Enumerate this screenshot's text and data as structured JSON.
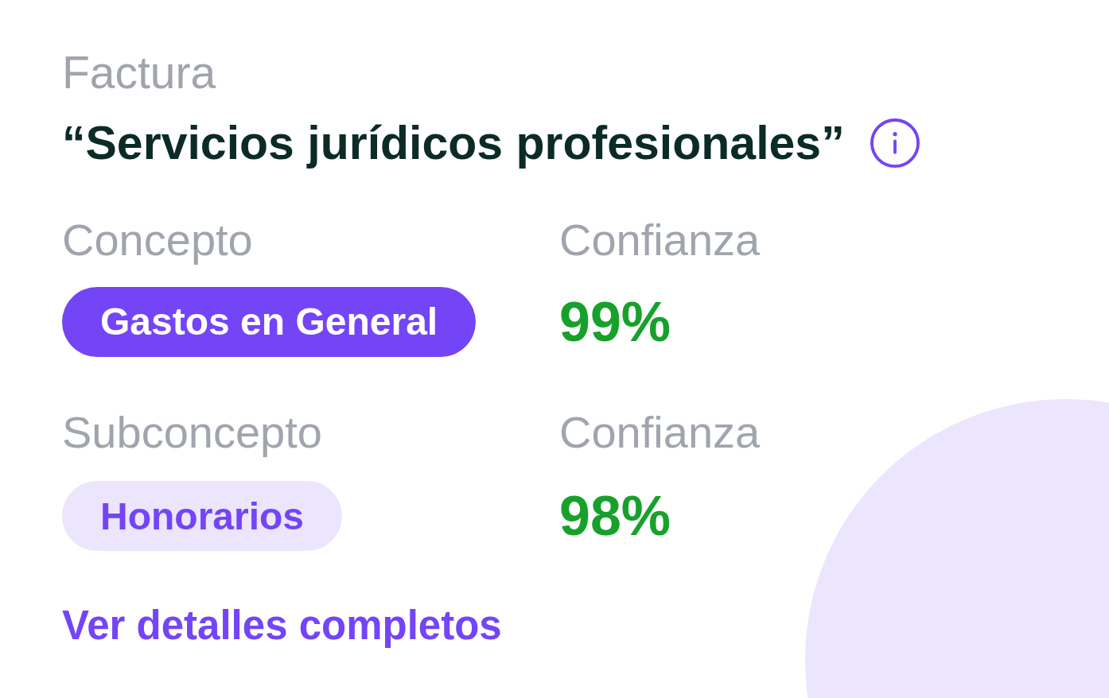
{
  "document_type": "Factura",
  "title": "“Servicios jurídicos profesionales”",
  "fields": [
    {
      "label": "Concepto",
      "value": "Gastos en General",
      "kind": "primary",
      "confidence_label": "Confianza",
      "confidence": "99%"
    },
    {
      "label": "Subconcepto",
      "value": "Honorarios",
      "kind": "secondary",
      "confidence_label": "Confianza",
      "confidence": "98%"
    }
  ],
  "details_link": "Ver detalles completos"
}
